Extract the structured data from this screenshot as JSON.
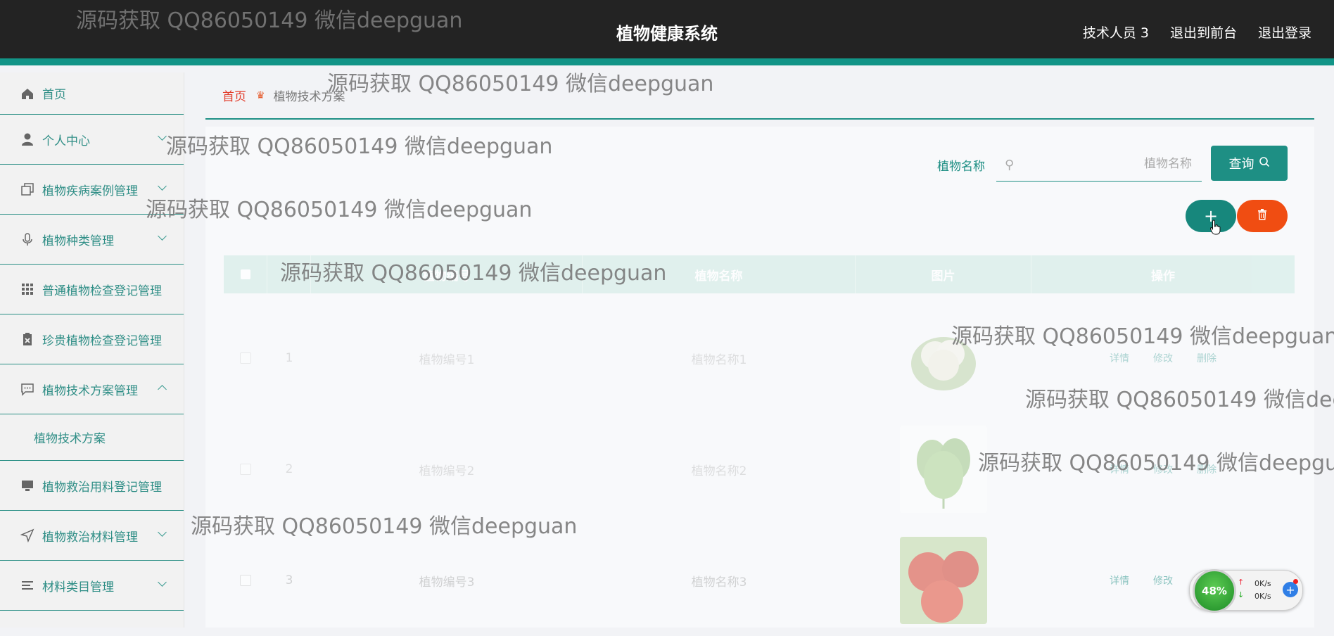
{
  "header": {
    "title": "植物健康系统",
    "user": "技术人员 3",
    "to_front": "退出到前台",
    "logout": "退出登录"
  },
  "sidebar": {
    "items": [
      {
        "label": "首页",
        "icon": "home-icon"
      },
      {
        "label": "个人中心",
        "icon": "user-icon"
      },
      {
        "label": "植物疾病案例管理",
        "icon": "copy-icon"
      },
      {
        "label": "植物种类管理",
        "icon": "microphone-icon"
      },
      {
        "label": "普通植物检查登记管理",
        "icon": "grid-icon"
      },
      {
        "label": "珍贵植物检查登记管理",
        "icon": "clipboard-x-icon"
      },
      {
        "label": "植物技术方案管理",
        "icon": "chat-icon"
      },
      {
        "label": "植物技术方案",
        "icon": ""
      },
      {
        "label": "植物救治用料登记管理",
        "icon": "monitor-icon"
      },
      {
        "label": "植物救治材料管理",
        "icon": "send-icon"
      },
      {
        "label": "材料类目管理",
        "icon": "list-icon"
      }
    ]
  },
  "breadcrumb": {
    "home": "首页",
    "current": "植物技术方案"
  },
  "search": {
    "label": "植物名称",
    "placeholder": "植物名称",
    "button": "查询"
  },
  "table": {
    "columns": [
      "",
      "植物编号",
      "植物名称",
      "图片",
      "操作"
    ],
    "rows": [
      {
        "index": "1",
        "code": "植物编号1",
        "name": "植物名称1",
        "image": "cauliflower",
        "ops": [
          "详情",
          "修改",
          "删除"
        ]
      },
      {
        "index": "2",
        "code": "植物编号2",
        "name": "植物名称2",
        "image": "greens",
        "ops": [
          "详情",
          "修改",
          "删除"
        ]
      },
      {
        "index": "3",
        "code": "植物编号3",
        "name": "植物名称3",
        "image": "tomato",
        "ops": [
          "详情",
          "修改",
          "删除"
        ]
      }
    ]
  },
  "watermark": "源码获取 QQ86050149 微信deepguan",
  "speed_widget": {
    "percent": "48%",
    "up": "0K/s",
    "down": "0K/s"
  },
  "colors": {
    "accent": "#1e8f84",
    "danger": "#f04d12",
    "topbar": "#232323"
  }
}
